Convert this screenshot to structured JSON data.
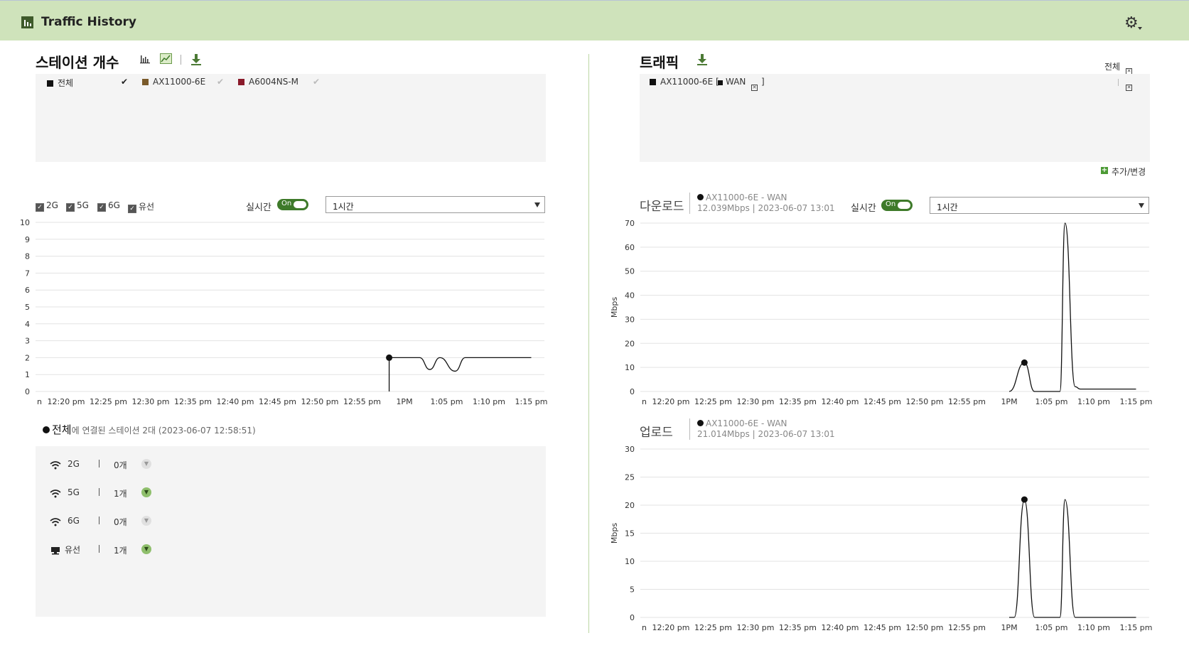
{
  "header": {
    "title": "Traffic History"
  },
  "stations": {
    "title": "스테이션 개수",
    "legend": [
      {
        "label": "전체",
        "color": "#111111",
        "checked": true
      },
      {
        "label": "AX11000-6E",
        "color": "#7a5a2a",
        "checked": false
      },
      {
        "label": "A6004NS-M",
        "color": "#8a1a2a",
        "checked": false
      }
    ],
    "band_filters": [
      "2G",
      "5G",
      "6G",
      "유선"
    ],
    "realtime_label": "실시간",
    "toggle_label": "On",
    "range_value": "1시간",
    "summary_title": "전체",
    "summary_text": "에 연결된 스테이션 2대 (2023-06-07 12:58:51)",
    "bands": [
      {
        "name": "2G",
        "count": "0개",
        "icon": "wifi-icon",
        "active": false
      },
      {
        "name": "5G",
        "count": "1개",
        "icon": "wifi-icon",
        "active": true
      },
      {
        "name": "6G",
        "count": "0개",
        "icon": "wifi-icon",
        "active": false
      },
      {
        "name": "유선",
        "count": "1개",
        "icon": "wired-icon",
        "active": true
      }
    ]
  },
  "traffic": {
    "title": "트래픽",
    "all_label": "전체",
    "device_legend": "AX11000-6E [",
    "wan_label": "WAN",
    "close_bracket": "]",
    "add_change_label": "추가/변경",
    "realtime_label": "실시간",
    "toggle_label": "On",
    "range_value": "1시간",
    "download": {
      "title": "다운로드",
      "series_label": "AX11000-6E - WAN",
      "value_text": "12.039Mbps | 2023-06-07 13:01"
    },
    "upload": {
      "title": "업로드",
      "series_label": "AX11000-6E - WAN",
      "value_text": "21.014Mbps | 2023-06-07 13:01"
    }
  },
  "chart_data": [
    {
      "type": "line",
      "name": "stations",
      "x": [
        "12:20 pm",
        "12:25 pm",
        "12:30 pm",
        "12:35 pm",
        "12:40 pm",
        "12:45 pm",
        "12:50 pm",
        "12:55 pm",
        "1PM",
        "1:05 pm",
        "1:10 pm",
        "1:15 pm"
      ],
      "x_first_partial": "n",
      "ylim": [
        0,
        10
      ],
      "yticks": [
        0,
        1,
        2,
        3,
        4,
        5,
        6,
        7,
        8,
        9,
        10
      ],
      "ylabel": "",
      "series": [
        {
          "values": [
            null,
            null,
            null,
            null,
            null,
            null,
            null,
            null,
            2,
            1.3,
            2,
            2
          ]
        }
      ],
      "points": [
        [
          12.97,
          0
        ],
        [
          12.97,
          2
        ],
        [
          13.03,
          2
        ],
        [
          13.05,
          1.3
        ],
        [
          13.07,
          2
        ],
        [
          13.1,
          1.2
        ],
        [
          13.12,
          2
        ],
        [
          13.25,
          2
        ]
      ],
      "marker": [
        12.97,
        2
      ]
    },
    {
      "type": "line",
      "name": "download",
      "x": [
        "12:20 pm",
        "12:25 pm",
        "12:30 pm",
        "12:35 pm",
        "12:40 pm",
        "12:45 pm",
        "12:50 pm",
        "12:55 pm",
        "1PM",
        "1:05 pm",
        "1:10 pm",
        "1:15 pm"
      ],
      "x_first_partial": "n",
      "ylim": [
        0,
        70
      ],
      "yticks": [
        0,
        10,
        20,
        30,
        40,
        50,
        60,
        70
      ],
      "ylabel": "Mbps",
      "points": [
        [
          13.0,
          0
        ],
        [
          13.03,
          12
        ],
        [
          13.05,
          0
        ],
        [
          13.1,
          0
        ],
        [
          13.11,
          70
        ],
        [
          13.13,
          2
        ],
        [
          13.14,
          1
        ],
        [
          13.25,
          1
        ]
      ],
      "marker": [
        13.03,
        12
      ]
    },
    {
      "type": "line",
      "name": "upload",
      "x": [
        "12:20 pm",
        "12:25 pm",
        "12:30 pm",
        "12:35 pm",
        "12:40 pm",
        "12:45 pm",
        "12:50 pm",
        "12:55 pm",
        "1PM",
        "1:05 pm",
        "1:10 pm",
        "1:15 pm"
      ],
      "x_first_partial": "n",
      "ylim": [
        0,
        30
      ],
      "yticks": [
        0,
        5,
        10,
        15,
        20,
        25,
        30
      ],
      "ylabel": "Mbps",
      "points": [
        [
          13.0,
          0
        ],
        [
          13.01,
          0
        ],
        [
          13.03,
          21
        ],
        [
          13.05,
          0
        ],
        [
          13.1,
          0
        ],
        [
          13.11,
          21
        ],
        [
          13.13,
          0
        ],
        [
          13.25,
          0
        ]
      ],
      "marker": [
        13.03,
        21
      ]
    }
  ]
}
